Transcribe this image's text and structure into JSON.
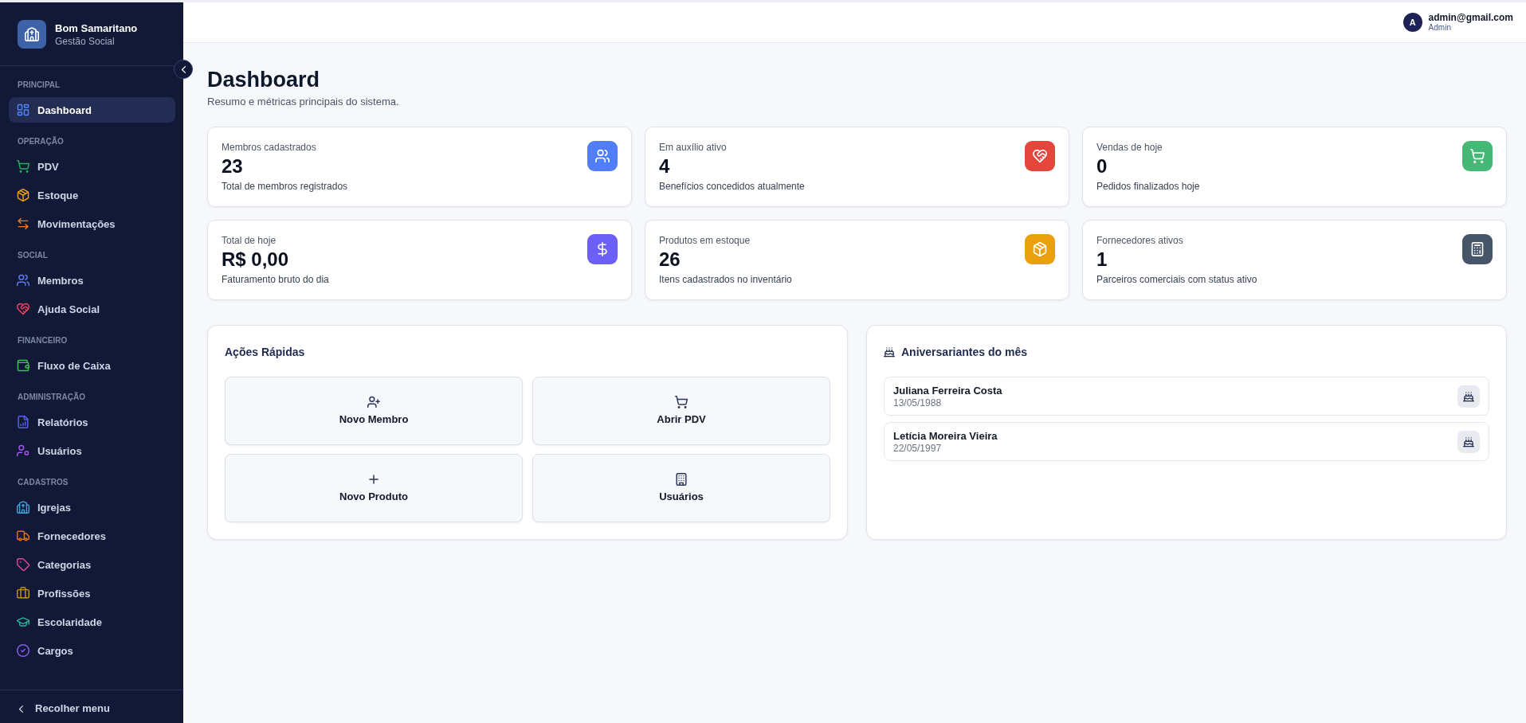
{
  "sidebar": {
    "brand": {
      "title": "Bom Samaritano",
      "subtitle": "Gestão Social"
    },
    "sections": [
      {
        "label": "PRINCIPAL",
        "items": [
          {
            "label": "Dashboard",
            "color": "#4f86f7",
            "selected": true
          }
        ]
      },
      {
        "label": "OPERAÇÃO",
        "items": [
          {
            "label": "PDV",
            "color": "#22b05a",
            "selected": false
          },
          {
            "label": "Estoque",
            "color": "#f2a20c",
            "selected": false
          },
          {
            "label": "Movimentações",
            "color": "#f07a1c",
            "selected": false
          }
        ]
      },
      {
        "label": "SOCIAL",
        "items": [
          {
            "label": "Membros",
            "color": "#5b7df2",
            "selected": false
          },
          {
            "label": "Ajuda Social",
            "color": "#ef4461",
            "selected": false
          }
        ]
      },
      {
        "label": "FINANCEIRO",
        "items": [
          {
            "label": "Fluxo de Caixa",
            "color": "#3cc05c",
            "selected": false
          }
        ]
      },
      {
        "label": "ADMINISTRAÇÃO",
        "items": [
          {
            "label": "Relatórios",
            "color": "#5b5cf0",
            "selected": false
          },
          {
            "label": "Usuários",
            "color": "#a552f0",
            "selected": false
          }
        ]
      },
      {
        "label": "CADASTROS",
        "items": [
          {
            "label": "Igrejas",
            "color": "#3d9fd6",
            "selected": false
          },
          {
            "label": "Fornecedores",
            "color": "#dd7410",
            "selected": false
          },
          {
            "label": "Categorias",
            "color": "#d9469f",
            "selected": false
          },
          {
            "label": "Profissões",
            "color": "#c8900e",
            "selected": false
          },
          {
            "label": "Escolaridade",
            "color": "#25b39a",
            "selected": false
          },
          {
            "label": "Cargos",
            "color": "#8b5cf6",
            "selected": false
          }
        ]
      }
    ],
    "footer": {
      "label": "Recolher menu"
    }
  },
  "header": {
    "user": {
      "initial": "A",
      "email": "admin@gmail.com",
      "role": "Admin"
    }
  },
  "page": {
    "title": "Dashboard",
    "subtitle": "Resumo e métricas principais do sistema."
  },
  "stats": [
    {
      "label": "Membros cadastrados",
      "value": "23",
      "description": "Total de membros registrados",
      "color": "#4f7ef8"
    },
    {
      "label": "Em auxílio ativo",
      "value": "4",
      "description": "Benefícios concedidos atualmente",
      "color": "#e3463b"
    },
    {
      "label": "Vendas de hoje",
      "value": "0",
      "description": "Pedidos finalizados hoje",
      "color": "#45b877"
    },
    {
      "label": "Total de hoje",
      "value": "R$ 0,00",
      "description": "Faturamento bruto do dia",
      "color": "#6b5ff5"
    },
    {
      "label": "Produtos em estoque",
      "value": "26",
      "description": "Itens cadastrados no inventário",
      "color": "#eaa00c"
    },
    {
      "label": "Fornecedores ativos",
      "value": "1",
      "description": "Parceiros comerciais com status ativo",
      "color": "#475569"
    }
  ],
  "quick_actions": {
    "title": "Ações Rápidas",
    "actions": [
      {
        "label": "Novo Membro"
      },
      {
        "label": "Abrir PDV"
      },
      {
        "label": "Novo Produto"
      },
      {
        "label": "Usuários"
      }
    ]
  },
  "birthdays": {
    "title": "Aniversariantes do mês",
    "people": [
      {
        "name": "Juliana Ferreira Costa",
        "date": "13/05/1988"
      },
      {
        "name": "Letícia Moreira Vieira",
        "date": "22/05/1997"
      }
    ]
  }
}
